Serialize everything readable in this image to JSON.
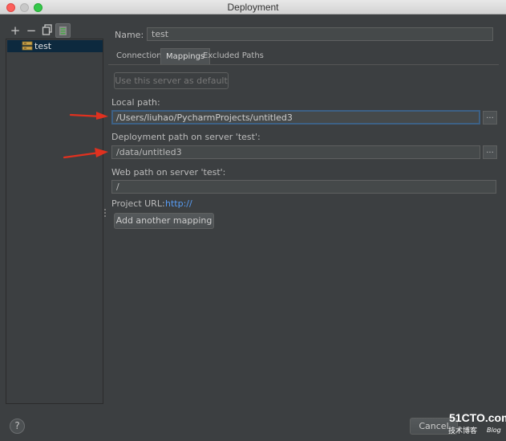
{
  "window": {
    "title": "Deployment"
  },
  "toolbar": {
    "add_label": "+",
    "remove_label": "−"
  },
  "server_list": {
    "items": [
      {
        "label": "test"
      }
    ]
  },
  "name_field": {
    "label": "Name:",
    "value": "test"
  },
  "tabs": [
    {
      "label": "Connection",
      "active": false
    },
    {
      "label": "Mappings",
      "active": true
    },
    {
      "label": "Excluded Paths",
      "active": false
    }
  ],
  "mappings": {
    "default_button": "Use this server as default",
    "local_path": {
      "label": "Local path:",
      "value": "/Users/liuhao/PycharmProjects/untitled3"
    },
    "deployment_path": {
      "label": "Deployment path on server 'test':",
      "value": "/data/untitled3"
    },
    "web_path": {
      "label": "Web path on server 'test':",
      "value": "/"
    },
    "project_url": {
      "label": "Project URL:",
      "value": "http://"
    },
    "add_mapping_button": "Add another mapping",
    "browse_label": "..."
  },
  "footer": {
    "help_label": "?",
    "cancel_label": "Cancel"
  },
  "watermark": {
    "main": "51CTO.com",
    "sub": "技术博客",
    "blog": "Blog"
  },
  "colors": {
    "background": "#3c3f41",
    "selection": "#0d293e",
    "link": "#589df6",
    "arrow": "#e0311f",
    "focus": "#3d6185"
  }
}
